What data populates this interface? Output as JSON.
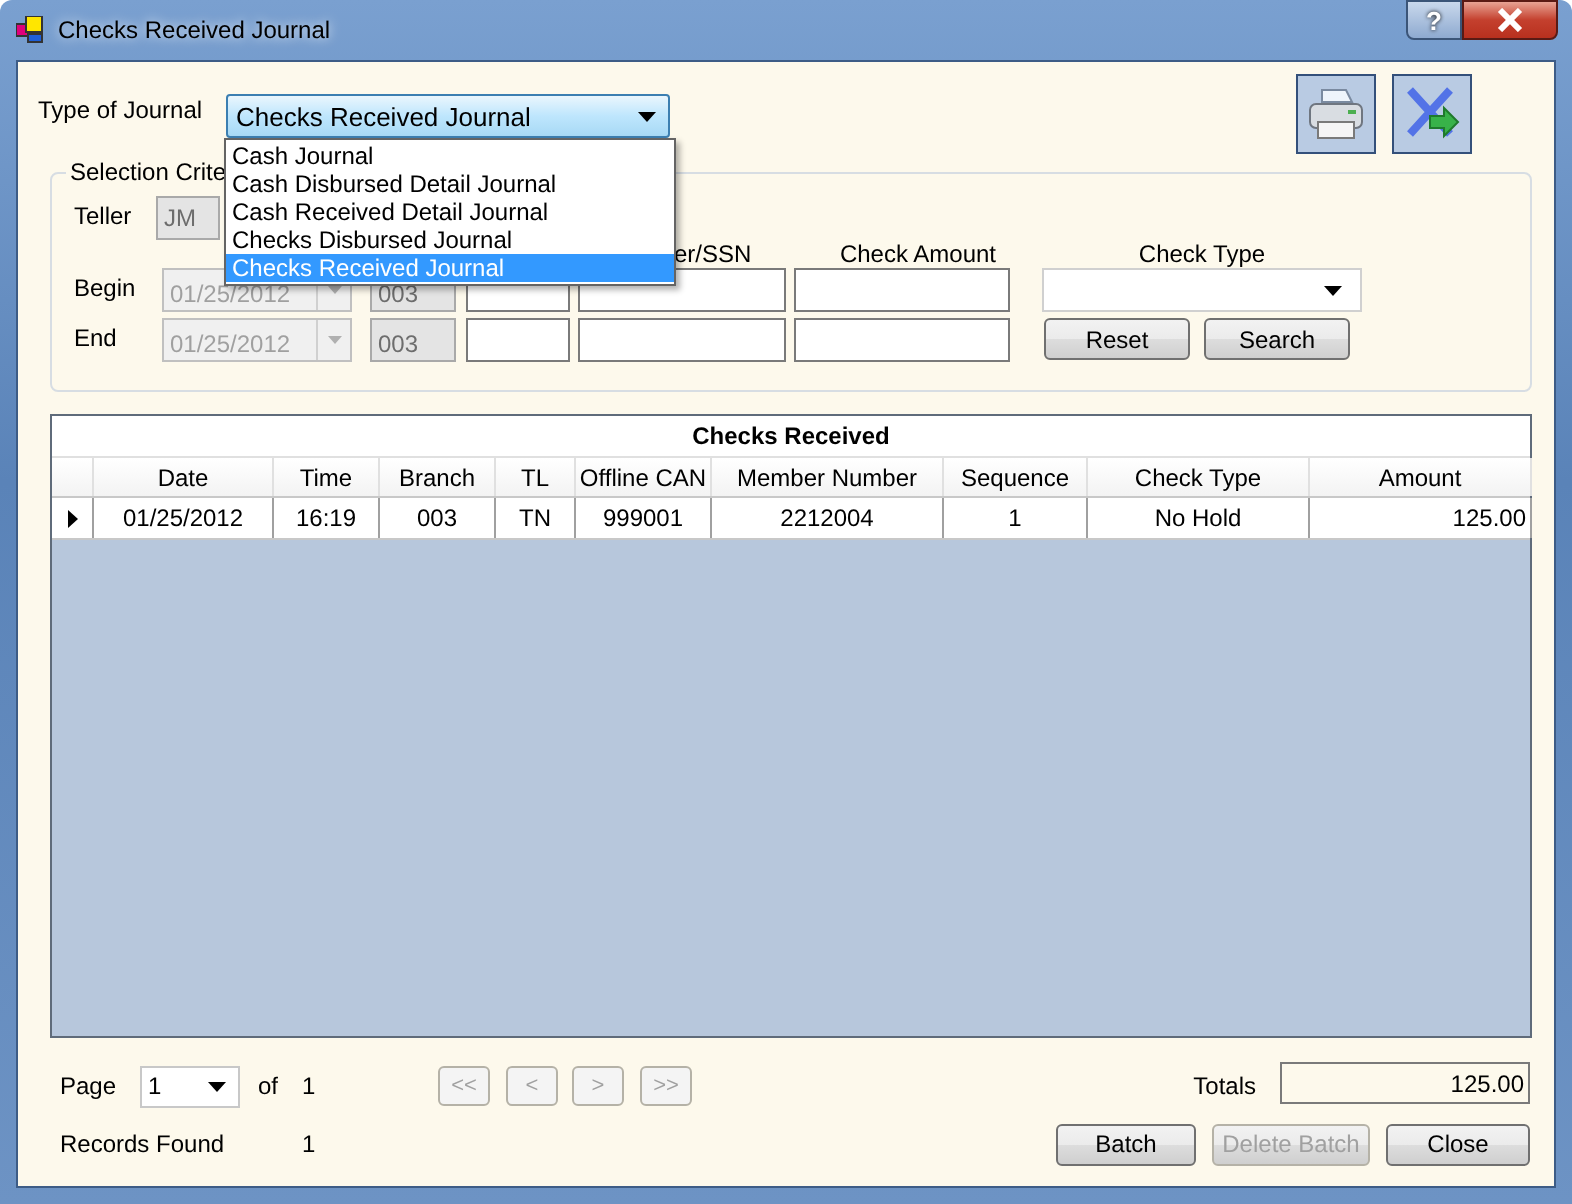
{
  "window": {
    "title": "Checks Received Journal",
    "help": "?"
  },
  "journal_type": {
    "label": "Type of Journal",
    "value": "Checks Received Journal",
    "expanded": true,
    "options": [
      {
        "label": "Cash Journal",
        "selected": false
      },
      {
        "label": "Cash Disbursed Detail Journal",
        "selected": false
      },
      {
        "label": "Cash Received Detail Journal",
        "selected": false
      },
      {
        "label": "Checks Disbursed Journal",
        "selected": false
      },
      {
        "label": "Checks Received Journal",
        "selected": true
      }
    ]
  },
  "selection_criteria": {
    "legend": "Selection Crite",
    "teller_label": "Teller",
    "teller": "JM",
    "headers": {
      "member": "er/SSN",
      "amount": "Check Amount",
      "check_type": "Check Type"
    },
    "rows": [
      {
        "label": "Begin",
        "date": "01/25/2012",
        "date_disabled": true,
        "branch": "003"
      },
      {
        "label": "End",
        "date": "01/25/2012",
        "date_disabled": true,
        "branch": "003"
      }
    ],
    "buttons": [
      "Reset",
      "Search"
    ]
  },
  "grid": {
    "caption": "Checks Received",
    "columns": [
      "Date",
      "Time",
      "Branch",
      "TL",
      "Offline CAN",
      "Member Number",
      "Sequence",
      "Check Type",
      "Amount"
    ],
    "rows": [
      {
        "current": true,
        "cells": [
          "01/25/2012",
          "16:19",
          "003",
          "TN",
          "999001",
          "2212004",
          "1",
          "No Hold",
          "125.00"
        ]
      }
    ]
  },
  "footer": {
    "page_label": "Page",
    "page": "1",
    "of_label": "of",
    "page_count": "1",
    "nav": [
      {
        "label": "<<",
        "disabled": true
      },
      {
        "label": "<",
        "disabled": true
      },
      {
        "label": ">",
        "disabled": true
      },
      {
        "label": ">>",
        "disabled": true
      }
    ],
    "totals_label": "Totals",
    "totals": "125.00",
    "records_label": "Records Found",
    "records": "1",
    "buttons": [
      {
        "label": "Batch",
        "disabled": false
      },
      {
        "label": "Delete Batch",
        "disabled": true
      },
      {
        "label": "Close",
        "disabled": false
      }
    ]
  }
}
